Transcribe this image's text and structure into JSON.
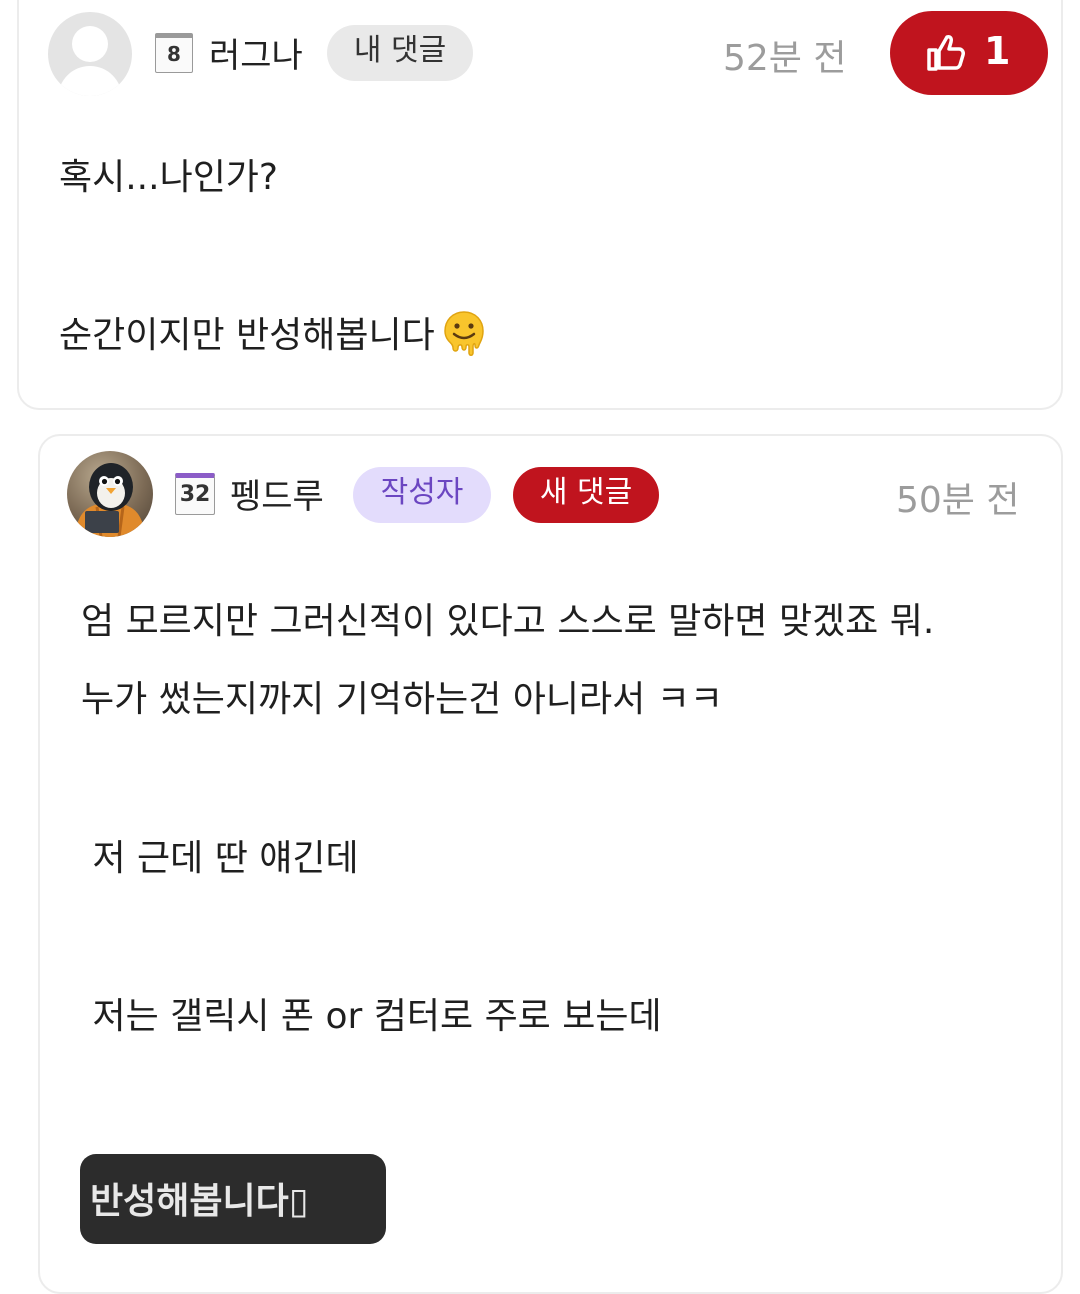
{
  "comments": [
    {
      "level": "8",
      "nickname": "러그나",
      "badges": [
        {
          "label": "내 댓글",
          "bg": "#e9e9e9",
          "fg": "#333333"
        }
      ],
      "time": "52분 전",
      "like_count": "1",
      "like_color": "#c0141e",
      "body": [
        "혹시...나인가?",
        "순간이지만 반성해봅니다"
      ],
      "emoji": "melting-face"
    },
    {
      "level": "32",
      "nickname": "펭드루",
      "badges": [
        {
          "label": "작성자",
          "bg": "#e3dcfc",
          "fg": "#6b46c1"
        },
        {
          "label": "새 댓글",
          "bg": "#c0141e",
          "fg": "#ffffff"
        }
      ],
      "time": "50분 전",
      "body": [
        "엄 모르지만 그러신적이 있다고 스스로 말하면 맞겠죠 뭐.",
        "누가 썼는지까지 기억하는건 아니라서 ㅋㅋ",
        " 저 근데 딴 얘긴데",
        " 저는 갤릭시 폰 or 컴터로 주로 보는데"
      ],
      "embedded_text": "반성해봅니다▯"
    }
  ]
}
